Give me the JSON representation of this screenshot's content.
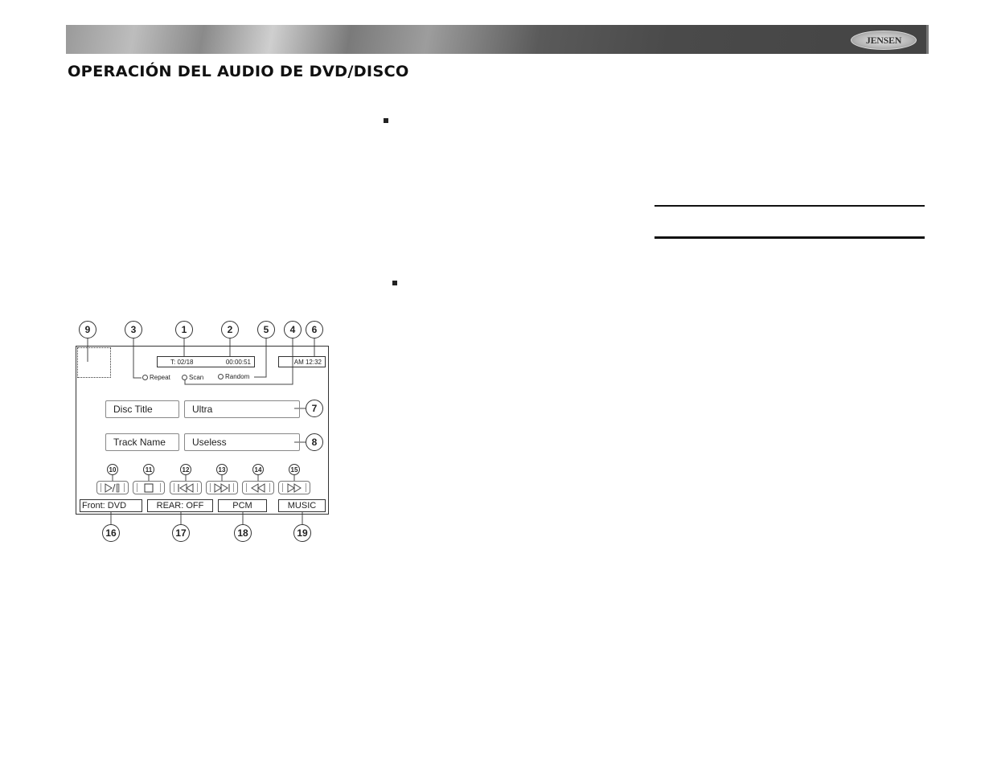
{
  "header": {
    "brand_logo_text": "JENSEN",
    "page_title": "OPERACIÓN DEL AUDIO DE DVD/DISCO"
  },
  "diagram": {
    "callouts_top": [
      "9",
      "3",
      "1",
      "2",
      "5",
      "4",
      "6"
    ],
    "callouts_right": [
      "7",
      "8"
    ],
    "callouts_controls": [
      "10",
      "11",
      "12",
      "13",
      "14",
      "15"
    ],
    "callouts_bottom": [
      "16",
      "17",
      "18",
      "19"
    ],
    "track_counter": "T: 02/18",
    "elapsed_time": "00:00:51",
    "clock": "AM 12:32",
    "modes": [
      "Repeat",
      "Scan",
      "Random"
    ],
    "disc_title_label": "Disc Title",
    "disc_title_value": "Ultra",
    "track_name_label": "Track Name",
    "track_name_value": "Useless",
    "controls": [
      {
        "icon": "play-pause-icon"
      },
      {
        "icon": "stop-icon"
      },
      {
        "icon": "previous-track-icon"
      },
      {
        "icon": "next-track-icon"
      },
      {
        "icon": "rewind-icon"
      },
      {
        "icon": "fast-forward-icon"
      }
    ],
    "status_bar": [
      "Front: DVD",
      "REAR: OFF",
      "PCM",
      "MUSIC"
    ]
  }
}
